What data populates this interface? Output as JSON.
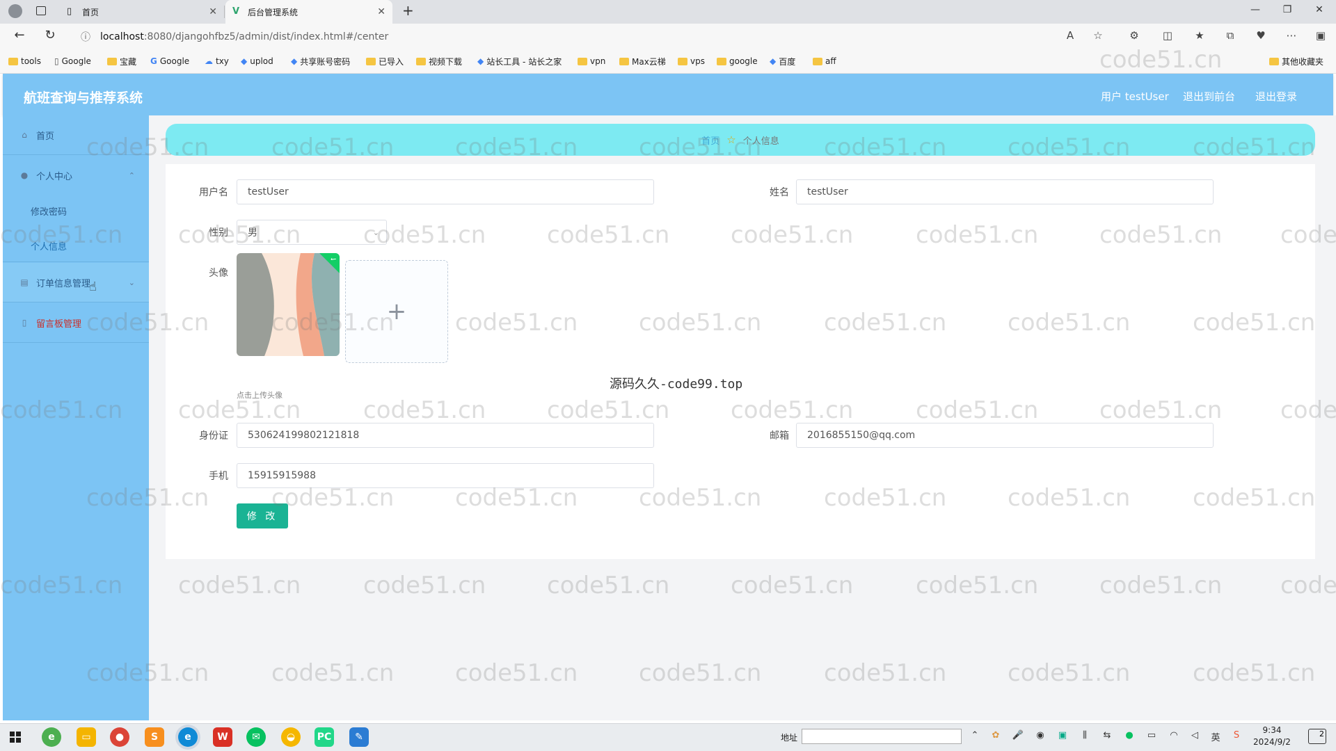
{
  "browser": {
    "tabs": [
      {
        "title": "首页",
        "icon": "page-icon"
      },
      {
        "title": "后台管理系统",
        "icon": "vue-logo-icon"
      }
    ],
    "url": "localhost:8080/djangohfbz5/admin/dist/index.html#/center",
    "url_host": "localhost",
    "url_rest": ":8080/djangohfbz5/admin/dist/index.html#/center",
    "bookmarks": [
      {
        "label": "tools",
        "type": "folder"
      },
      {
        "label": "Google",
        "type": "page"
      },
      {
        "label": "宝藏",
        "type": "folder"
      },
      {
        "label": "Google",
        "type": "google"
      },
      {
        "label": "txy",
        "type": "cloud"
      },
      {
        "label": "uplod",
        "type": "site"
      },
      {
        "label": "共享账号密码",
        "type": "site"
      },
      {
        "label": "已导入",
        "type": "folder"
      },
      {
        "label": "视频下载",
        "type": "folder"
      },
      {
        "label": "站长工具 - 站长之家",
        "type": "site"
      },
      {
        "label": "vpn",
        "type": "folder"
      },
      {
        "label": "Max云梯",
        "type": "folder"
      },
      {
        "label": "vps",
        "type": "folder"
      },
      {
        "label": "google",
        "type": "folder"
      },
      {
        "label": "百度",
        "type": "site"
      },
      {
        "label": "aff",
        "type": "folder"
      }
    ],
    "other_bookmarks": "其他收藏夹"
  },
  "header": {
    "title": "航班查询与推荐系统",
    "user_label": "用户 testUser",
    "to_front": "退出到前台",
    "logout": "退出登录"
  },
  "sidebar": {
    "items": [
      {
        "label": "首页",
        "icon": "home-icon"
      },
      {
        "label": "个人中心",
        "icon": "user-icon"
      },
      {
        "label": "修改密码"
      },
      {
        "label": "个人信息"
      },
      {
        "label": "订单信息管理",
        "icon": "document-icon"
      },
      {
        "label": "留言板管理",
        "icon": "message-icon"
      }
    ]
  },
  "breadcrumb": {
    "home": "首页",
    "current": "个人信息"
  },
  "form": {
    "username_label": "用户名",
    "username_value": "testUser",
    "name_label": "姓名",
    "name_value": "testUser",
    "gender_label": "性别",
    "gender_value": "男",
    "avatar_label": "头像",
    "upload_hint": "点击上传头像",
    "id_label": "身份证",
    "id_value": "530624199802121818",
    "email_label": "邮箱",
    "email_value": "2016855150@qq.com",
    "phone_label": "手机",
    "phone_value": "15915915988",
    "submit_label": "修 改"
  },
  "overlay_text": "源码久久-code99.top",
  "watermark": "code51.cn",
  "taskbar": {
    "address_label": "地址",
    "time": "9:34",
    "date": "2024/9/2",
    "lang": "英",
    "notif_count": "2"
  },
  "colors": {
    "header_bg": "#7cc4f4",
    "breadcrumb_bg": "#7deaf2",
    "submit_bg": "#1ab394"
  }
}
